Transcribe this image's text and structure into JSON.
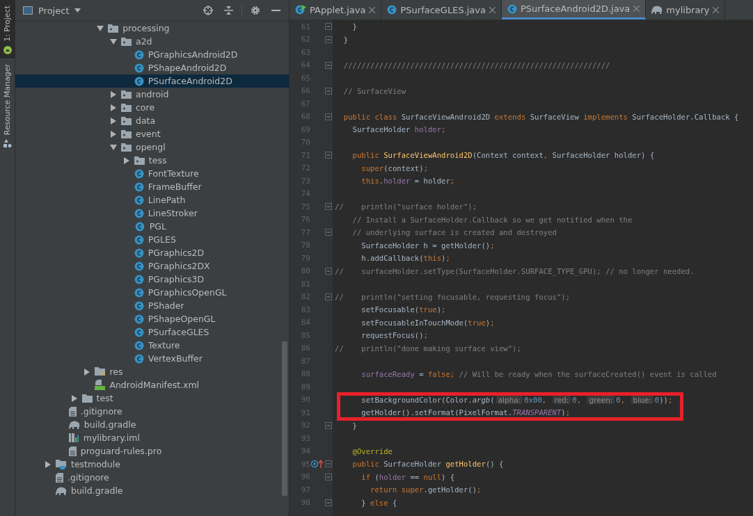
{
  "tool_strip": [
    {
      "label": "1: Project",
      "selected": true
    },
    {
      "label": "Resource Manager",
      "selected": false
    }
  ],
  "project_panel": {
    "title": "Project"
  },
  "tree": [
    {
      "children": [
        {
          "children": [
            {
              "children": [
                {
                  "children": [
                    {
                      "label": "processing",
                      "kind": "package",
                      "expanded": true,
                      "selected": false,
                      "children": [
                        {
                          "label": "a2d",
                          "kind": "package",
                          "expanded": true,
                          "selected": false,
                          "children": [
                            {
                              "label": "PGraphicsAndroid2D",
                              "kind": "class",
                              "selected": false
                            },
                            {
                              "label": "PShapeAndroid2D",
                              "kind": "class",
                              "selected": false
                            },
                            {
                              "label": "PSurfaceAndroid2D",
                              "kind": "class",
                              "selected": true
                            }
                          ]
                        },
                        {
                          "label": "android",
                          "kind": "package",
                          "expanded": false,
                          "selected": false
                        },
                        {
                          "label": "core",
                          "kind": "package",
                          "expanded": false,
                          "selected": false
                        },
                        {
                          "label": "data",
                          "kind": "package",
                          "expanded": false,
                          "selected": false
                        },
                        {
                          "label": "event",
                          "kind": "package",
                          "expanded": false,
                          "selected": false
                        },
                        {
                          "label": "opengl",
                          "kind": "package",
                          "expanded": true,
                          "selected": false,
                          "children": [
                            {
                              "label": "tess",
                              "kind": "package",
                              "expanded": false,
                              "selected": false
                            },
                            {
                              "label": "FontTexture",
                              "kind": "class",
                              "selected": false
                            },
                            {
                              "label": "FrameBuffer",
                              "kind": "class",
                              "selected": false
                            },
                            {
                              "label": "LinePath",
                              "kind": "class",
                              "selected": false
                            },
                            {
                              "label": "LineStroker",
                              "kind": "class",
                              "selected": false
                            },
                            {
                              "label": "PGL",
                              "kind": "abstract",
                              "selected": false
                            },
                            {
                              "label": "PGLES",
                              "kind": "class",
                              "selected": false
                            },
                            {
                              "label": "PGraphics2D",
                              "kind": "class",
                              "selected": false
                            },
                            {
                              "label": "PGraphics2DX",
                              "kind": "class",
                              "selected": false
                            },
                            {
                              "label": "PGraphics3D",
                              "kind": "class",
                              "selected": false
                            },
                            {
                              "label": "PGraphicsOpenGL",
                              "kind": "class",
                              "selected": false
                            },
                            {
                              "label": "PShader",
                              "kind": "class",
                              "selected": false
                            },
                            {
                              "label": "PShapeOpenGL",
                              "kind": "class",
                              "selected": false
                            },
                            {
                              "label": "PSurfaceGLES",
                              "kind": "class",
                              "selected": false
                            },
                            {
                              "label": "Texture",
                              "kind": "class",
                              "selected": false
                            },
                            {
                              "label": "VertexBuffer",
                              "kind": "class",
                              "selected": false
                            }
                          ]
                        }
                      ]
                    }
                  ]
                },
                {
                  "label": "res",
                  "kind": "res",
                  "expanded": false,
                  "selected": false
                },
                {
                  "label": "AndroidManifest.xml",
                  "kind": "manifest",
                  "selected": false
                }
              ]
            },
            {
              "label": "test",
              "kind": "folder",
              "expanded": false,
              "selected": false
            }
          ]
        },
        {
          "label": ".gitignore",
          "kind": "file",
          "selected": false
        },
        {
          "label": "build.gradle",
          "kind": "gradle",
          "selected": false
        },
        {
          "label": "mylibrary.iml",
          "kind": "iml",
          "selected": false
        },
        {
          "label": "proguard-rules.pro",
          "kind": "file",
          "selected": false
        }
      ]
    },
    {
      "label": "testmodule",
      "kind": "module",
      "expanded": false,
      "selected": false
    },
    {
      "label": ".gitignore",
      "kind": "file",
      "selected": false
    },
    {
      "label": "build.gradle",
      "kind": "gradle",
      "selected": false
    }
  ],
  "editor_tabs": [
    {
      "label": "PApplet.java",
      "kind": "runnable",
      "selected": false
    },
    {
      "label": "PSurfaceGLES.java",
      "kind": "class",
      "selected": false
    },
    {
      "label": "PSurfaceAndroid2D.java",
      "kind": "class",
      "selected": true
    },
    {
      "label": "mylibrary",
      "kind": "gradle",
      "selected": false
    }
  ],
  "code_lines": [
    {
      "number": "61",
      "fold": true,
      "highlighted": false,
      "tokens": [
        {
          "text": "    }",
          "kind": "plain"
        }
      ]
    },
    {
      "number": "62",
      "fold": true,
      "highlighted": false,
      "tokens": [
        {
          "text": "  }",
          "kind": "plain"
        }
      ]
    },
    {
      "number": "63",
      "fold": false,
      "highlighted": false
    },
    {
      "number": "64",
      "fold": true,
      "highlighted": false,
      "tokens": [
        {
          "text": "  ////////////////////////////////////////////////////////////",
          "kind": "comment"
        }
      ]
    },
    {
      "number": "65",
      "fold": false,
      "highlighted": false
    },
    {
      "number": "66",
      "fold": true,
      "highlighted": false,
      "tokens": [
        {
          "text": "  // SurfaceView",
          "kind": "comment"
        }
      ]
    },
    {
      "number": "67",
      "fold": false,
      "highlighted": false
    },
    {
      "number": "68",
      "fold": true,
      "highlighted": false,
      "tokens": [
        {
          "text": "  public class ",
          "kind": "kw"
        },
        {
          "text": "SurfaceViewAndroid2D ",
          "kind": "plain"
        },
        {
          "text": "extends ",
          "kind": "kw"
        },
        {
          "text": "SurfaceView ",
          "kind": "plain"
        },
        {
          "text": "implements ",
          "kind": "kw"
        },
        {
          "text": "SurfaceHolder.Callback {",
          "kind": "plain"
        }
      ]
    },
    {
      "number": "69",
      "fold": false,
      "highlighted": false,
      "tokens": [
        {
          "text": "    SurfaceHolder ",
          "kind": "plain"
        },
        {
          "text": "holder",
          "kind": "field"
        },
        {
          "text": ";",
          "kind": "kw"
        }
      ]
    },
    {
      "number": "70",
      "fold": false,
      "highlighted": false
    },
    {
      "number": "71",
      "fold": true,
      "highlighted": false,
      "tokens": [
        {
          "text": "    public ",
          "kind": "kw"
        },
        {
          "text": "SurfaceViewAndroid2D",
          "kind": "fn"
        },
        {
          "text": "(Context context",
          "kind": "plain"
        },
        {
          "text": ", ",
          "kind": "kw"
        },
        {
          "text": "SurfaceHolder holder) {",
          "kind": "plain"
        }
      ]
    },
    {
      "number": "72",
      "fold": false,
      "highlighted": false,
      "tokens": [
        {
          "text": "      super",
          "kind": "kw"
        },
        {
          "text": "(context)",
          "kind": "plain"
        },
        {
          "text": ";",
          "kind": "kw"
        }
      ]
    },
    {
      "number": "73",
      "fold": false,
      "highlighted": false,
      "tokens": [
        {
          "text": "      this",
          "kind": "kw"
        },
        {
          "text": ".",
          "kind": "plain"
        },
        {
          "text": "holder",
          "kind": "field"
        },
        {
          "text": " = holder",
          "kind": "plain"
        },
        {
          "text": ";",
          "kind": "kw"
        }
      ]
    },
    {
      "number": "74",
      "fold": false,
      "highlighted": false
    },
    {
      "number": "75",
      "fold": true,
      "highlighted": false,
      "tokens": [
        {
          "text": "//    println(\"surface holder\");",
          "kind": "comment"
        }
      ]
    },
    {
      "number": "76",
      "fold": false,
      "highlighted": false,
      "tokens": [
        {
          "text": "    // Install a SurfaceHolder.Callback so we get notified when the",
          "kind": "comment"
        }
      ]
    },
    {
      "number": "77",
      "fold": true,
      "highlighted": false,
      "tokens": [
        {
          "text": "    // underlying surface is created and destroyed",
          "kind": "comment"
        }
      ]
    },
    {
      "number": "78",
      "fold": false,
      "highlighted": false,
      "tokens": [
        {
          "text": "      SurfaceHolder h = getHolder()",
          "kind": "plain"
        },
        {
          "text": ";",
          "kind": "kw"
        }
      ]
    },
    {
      "number": "79",
      "fold": false,
      "highlighted": false,
      "tokens": [
        {
          "text": "      h.addCallback(",
          "kind": "plain"
        },
        {
          "text": "this",
          "kind": "kw"
        },
        {
          "text": ")",
          "kind": "plain"
        },
        {
          "text": ";",
          "kind": "kw"
        }
      ]
    },
    {
      "number": "80",
      "fold": true,
      "highlighted": false,
      "tokens": [
        {
          "text": "//    surfaceHolder.setType(SurfaceHolder.SURFACE_TYPE_GPU); // no longer needed.",
          "kind": "comment"
        }
      ]
    },
    {
      "number": "81",
      "fold": false,
      "highlighted": false
    },
    {
      "number": "82",
      "fold": true,
      "highlighted": false,
      "tokens": [
        {
          "text": "//    println(\"setting focusable, requesting focus\");",
          "kind": "comment"
        }
      ]
    },
    {
      "number": "83",
      "fold": false,
      "highlighted": false,
      "tokens": [
        {
          "text": "      setFocusable(",
          "kind": "plain"
        },
        {
          "text": "true",
          "kind": "kw"
        },
        {
          "text": ")",
          "kind": "plain"
        },
        {
          "text": ";",
          "kind": "kw"
        }
      ]
    },
    {
      "number": "84",
      "fold": false,
      "highlighted": false,
      "tokens": [
        {
          "text": "      setFocusableInTouchMode(",
          "kind": "plain"
        },
        {
          "text": "true",
          "kind": "kw"
        },
        {
          "text": ")",
          "kind": "plain"
        },
        {
          "text": ";",
          "kind": "kw"
        }
      ]
    },
    {
      "number": "85",
      "fold": false,
      "highlighted": false,
      "tokens": [
        {
          "text": "      requestFocus()",
          "kind": "plain"
        },
        {
          "text": ";",
          "kind": "kw"
        }
      ]
    },
    {
      "number": "86",
      "fold": false,
      "highlighted": false,
      "tokens": [
        {
          "text": "//    println(\"done making surface view\");",
          "kind": "comment"
        }
      ]
    },
    {
      "number": "87",
      "fold": false,
      "highlighted": false
    },
    {
      "number": "88",
      "fold": false,
      "highlighted": false,
      "tokens": [
        {
          "text": "      surfaceReady",
          "kind": "field"
        },
        {
          "text": " = ",
          "kind": "plain"
        },
        {
          "text": "false; ",
          "kind": "kw"
        },
        {
          "text": "// Will be ready when the surfaceCreated() event is called",
          "kind": "comment"
        }
      ]
    },
    {
      "number": "89",
      "fold": false,
      "highlighted": false
    },
    {
      "number": "90",
      "fold": false,
      "highlighted": true,
      "tokens": [
        {
          "text": "      setBackgroundColor(Color.",
          "kind": "plain"
        },
        {
          "text": "argb",
          "kind": "italic"
        },
        {
          "text": "(",
          "kind": "plain"
        },
        {
          "text": "alpha:",
          "kind": "hint"
        },
        {
          "text": "0x00",
          "kind": "num"
        },
        {
          "text": ", ",
          "kind": "kw"
        },
        {
          "text": "red:",
          "kind": "hint"
        },
        {
          "text": "0",
          "kind": "num"
        },
        {
          "text": ", ",
          "kind": "kw"
        },
        {
          "text": "green:",
          "kind": "hint"
        },
        {
          "text": "0",
          "kind": "num"
        },
        {
          "text": ", ",
          "kind": "kw"
        },
        {
          "text": "blue:",
          "kind": "hint"
        },
        {
          "text": "0",
          "kind": "num"
        },
        {
          "text": "))",
          "kind": "plain"
        },
        {
          "text": ";",
          "kind": "kw"
        }
      ]
    },
    {
      "number": "91",
      "fold": false,
      "highlighted": true,
      "tokens": [
        {
          "text": "      getHolder().setFormat(PixelFormat.",
          "kind": "plain"
        },
        {
          "text": "TRANSPARENT",
          "kind": "static"
        },
        {
          "text": ")",
          "kind": "plain"
        },
        {
          "text": ";",
          "kind": "kw"
        }
      ]
    },
    {
      "number": "92",
      "fold": true,
      "highlighted": false,
      "tokens": [
        {
          "text": "    }",
          "kind": "plain"
        }
      ]
    },
    {
      "number": "93",
      "fold": false,
      "highlighted": false
    },
    {
      "number": "94",
      "fold": false,
      "highlighted": false,
      "tokens": [
        {
          "text": "    @Override",
          "kind": "annot"
        }
      ]
    },
    {
      "number": "95",
      "fold": true,
      "highlighted": false,
      "gutter": {
        "kind": "overrides"
      },
      "tokens": [
        {
          "text": "    public ",
          "kind": "kw"
        },
        {
          "text": "SurfaceHolder ",
          "kind": "plain"
        },
        {
          "text": "getHolder",
          "kind": "fn"
        },
        {
          "text": "() {",
          "kind": "plain"
        }
      ]
    },
    {
      "number": "96",
      "fold": true,
      "highlighted": false,
      "tokens": [
        {
          "text": "      if ",
          "kind": "kw"
        },
        {
          "text": "(",
          "kind": "plain"
        },
        {
          "text": "holder",
          "kind": "field"
        },
        {
          "text": " == ",
          "kind": "plain"
        },
        {
          "text": "null",
          "kind": "kw"
        },
        {
          "text": ") {",
          "kind": "plain"
        }
      ]
    },
    {
      "number": "97",
      "fold": false,
      "highlighted": false,
      "tokens": [
        {
          "text": "        return super",
          "kind": "kw"
        },
        {
          "text": ".getHolder()",
          "kind": "plain"
        },
        {
          "text": ";",
          "kind": "kw"
        }
      ]
    },
    {
      "number": "98",
      "fold": true,
      "highlighted": false,
      "tokens": [
        {
          "text": "      } ",
          "kind": "plain"
        },
        {
          "text": "else ",
          "kind": "kw"
        },
        {
          "text": "{",
          "kind": "plain"
        }
      ]
    }
  ]
}
